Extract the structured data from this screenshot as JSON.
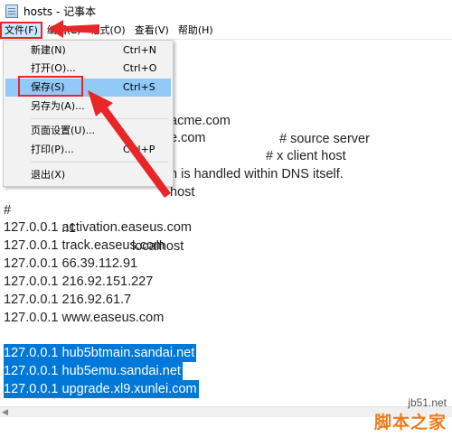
{
  "window": {
    "title": "hosts - 记事本"
  },
  "menubar": {
    "items": [
      {
        "name": "menu-file",
        "label": "文件(F)"
      },
      {
        "name": "menu-edit",
        "label": "编辑(E)"
      },
      {
        "name": "menu-format",
        "label": "格式(O)"
      },
      {
        "name": "menu-view",
        "label": "查看(V)"
      },
      {
        "name": "menu-help",
        "label": "帮助(H)"
      }
    ]
  },
  "file_menu": {
    "items": [
      {
        "label": "新建(N)",
        "shortcut": "Ctrl+N"
      },
      {
        "label": "打开(O)...",
        "shortcut": "Ctrl+O"
      },
      {
        "label": "保存(S)",
        "shortcut": "Ctrl+S"
      },
      {
        "label": "另存为(A)...",
        "shortcut": ""
      },
      {
        "label": "页面设置(U)...",
        "shortcut": ""
      },
      {
        "label": "打印(P)...",
        "shortcut": "Ctrl+P"
      },
      {
        "label": "退出(X)",
        "shortcut": ""
      }
    ]
  },
  "editor": {
    "partial_lines": [
      {
        "left": "acme.com",
        "right": "# source server"
      },
      {
        "left": "e.com",
        "right": "# x client host"
      },
      {
        "left": "n is handled within DNS itself."
      },
      {
        "left": "host"
      },
      {
        "left": "#",
        "mid": "::1",
        "right": "localhost"
      }
    ],
    "lines": [
      "127.0.0.1 activation.easeus.com",
      "127.0.0.1 track.easeus.com",
      "127.0.0.1 66.39.112.91",
      "127.0.0.1 216.92.151.227",
      "127.0.0.1 216.92.61.7",
      "127.0.0.1 www.easeus.com"
    ],
    "selected_lines": [
      "127.0.0.1 hub5btmain.sandai.net",
      "127.0.0.1 hub5emu.sandai.net",
      "127.0.0.1 upgrade.xl9.xunlei.com"
    ]
  },
  "watermark": {
    "top": "jb51.net",
    "main": "脚本之家"
  },
  "colors": {
    "selection": "#0078d7",
    "highlight": "#91c9f7",
    "annotation_red": "#e8262a"
  }
}
